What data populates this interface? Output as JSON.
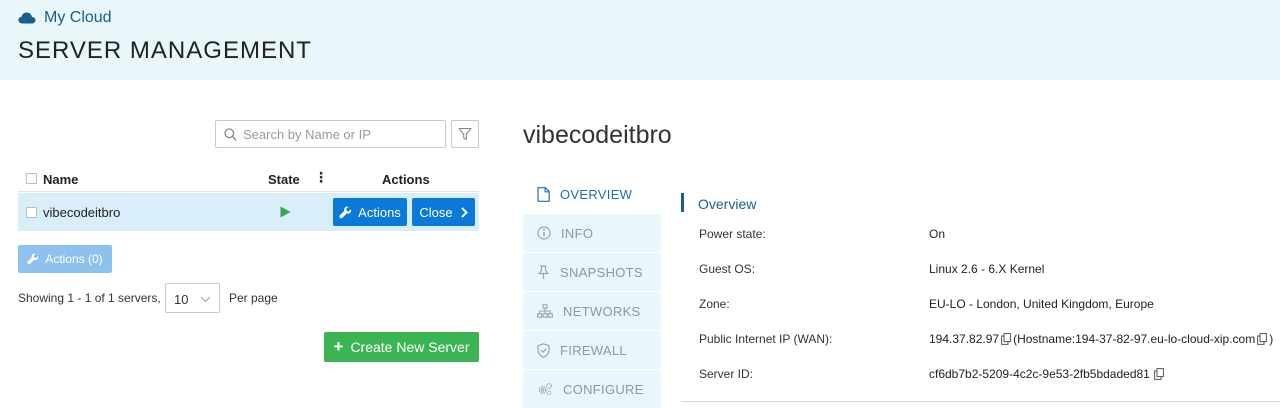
{
  "header": {
    "brand": "My Cloud",
    "title": "SERVER MANAGEMENT"
  },
  "search": {
    "placeholder": "Search by Name or IP",
    "value": ""
  },
  "table": {
    "columns": {
      "name": "Name",
      "state": "State",
      "actions": "Actions"
    },
    "rows": [
      {
        "name": "vibecodeitbro",
        "state": "running",
        "actions_label": "Actions",
        "close_label": "Close"
      }
    ]
  },
  "bulk_actions_label": "Actions (0)",
  "pagination": {
    "showing": "Showing 1 - 1 of 1 servers,",
    "per_page_value": "10",
    "per_page_label": "Per page"
  },
  "create_button": "Create New Server",
  "detail": {
    "server_name": "vibecodeitbro",
    "tabs": [
      {
        "label": "OVERVIEW",
        "icon": "document-icon",
        "active": true
      },
      {
        "label": "INFO",
        "icon": "info-icon",
        "active": false
      },
      {
        "label": "SNAPSHOTS",
        "icon": "pin-icon",
        "active": false
      },
      {
        "label": "NETWORKS",
        "icon": "network-icon",
        "active": false
      },
      {
        "label": "FIREWALL",
        "icon": "shield-icon",
        "active": false
      },
      {
        "label": "CONFIGURE",
        "icon": "gears-icon",
        "active": false
      }
    ],
    "overview": {
      "title": "Overview",
      "fields": {
        "power_state": {
          "label": "Power state:",
          "value": "On"
        },
        "guest_os": {
          "label": "Guest OS:",
          "value": "Linux 2.6 - 6.X Kernel"
        },
        "zone": {
          "label": "Zone:",
          "value": "EU-LO - London, United Kingdom, Europe"
        },
        "public_ip": {
          "label": "Public Internet IP (WAN):",
          "value": "194.37.82.97",
          "hostname_prefix": "(Hostname: ",
          "hostname": "194-37-82-97.eu-lo-cloud-xip.com",
          "hostname_suffix": ")"
        },
        "server_id": {
          "label": "Server ID:",
          "value": "cf6db7b2-5209-4c2c-9e53-2fb5bdaded81"
        }
      }
    }
  },
  "colors": {
    "header_bg": "#e9f6fa",
    "primary": "#0a79d7",
    "success": "#3cb453",
    "brand_text": "#1a5f8c",
    "row_highlight": "#d9eef8"
  }
}
